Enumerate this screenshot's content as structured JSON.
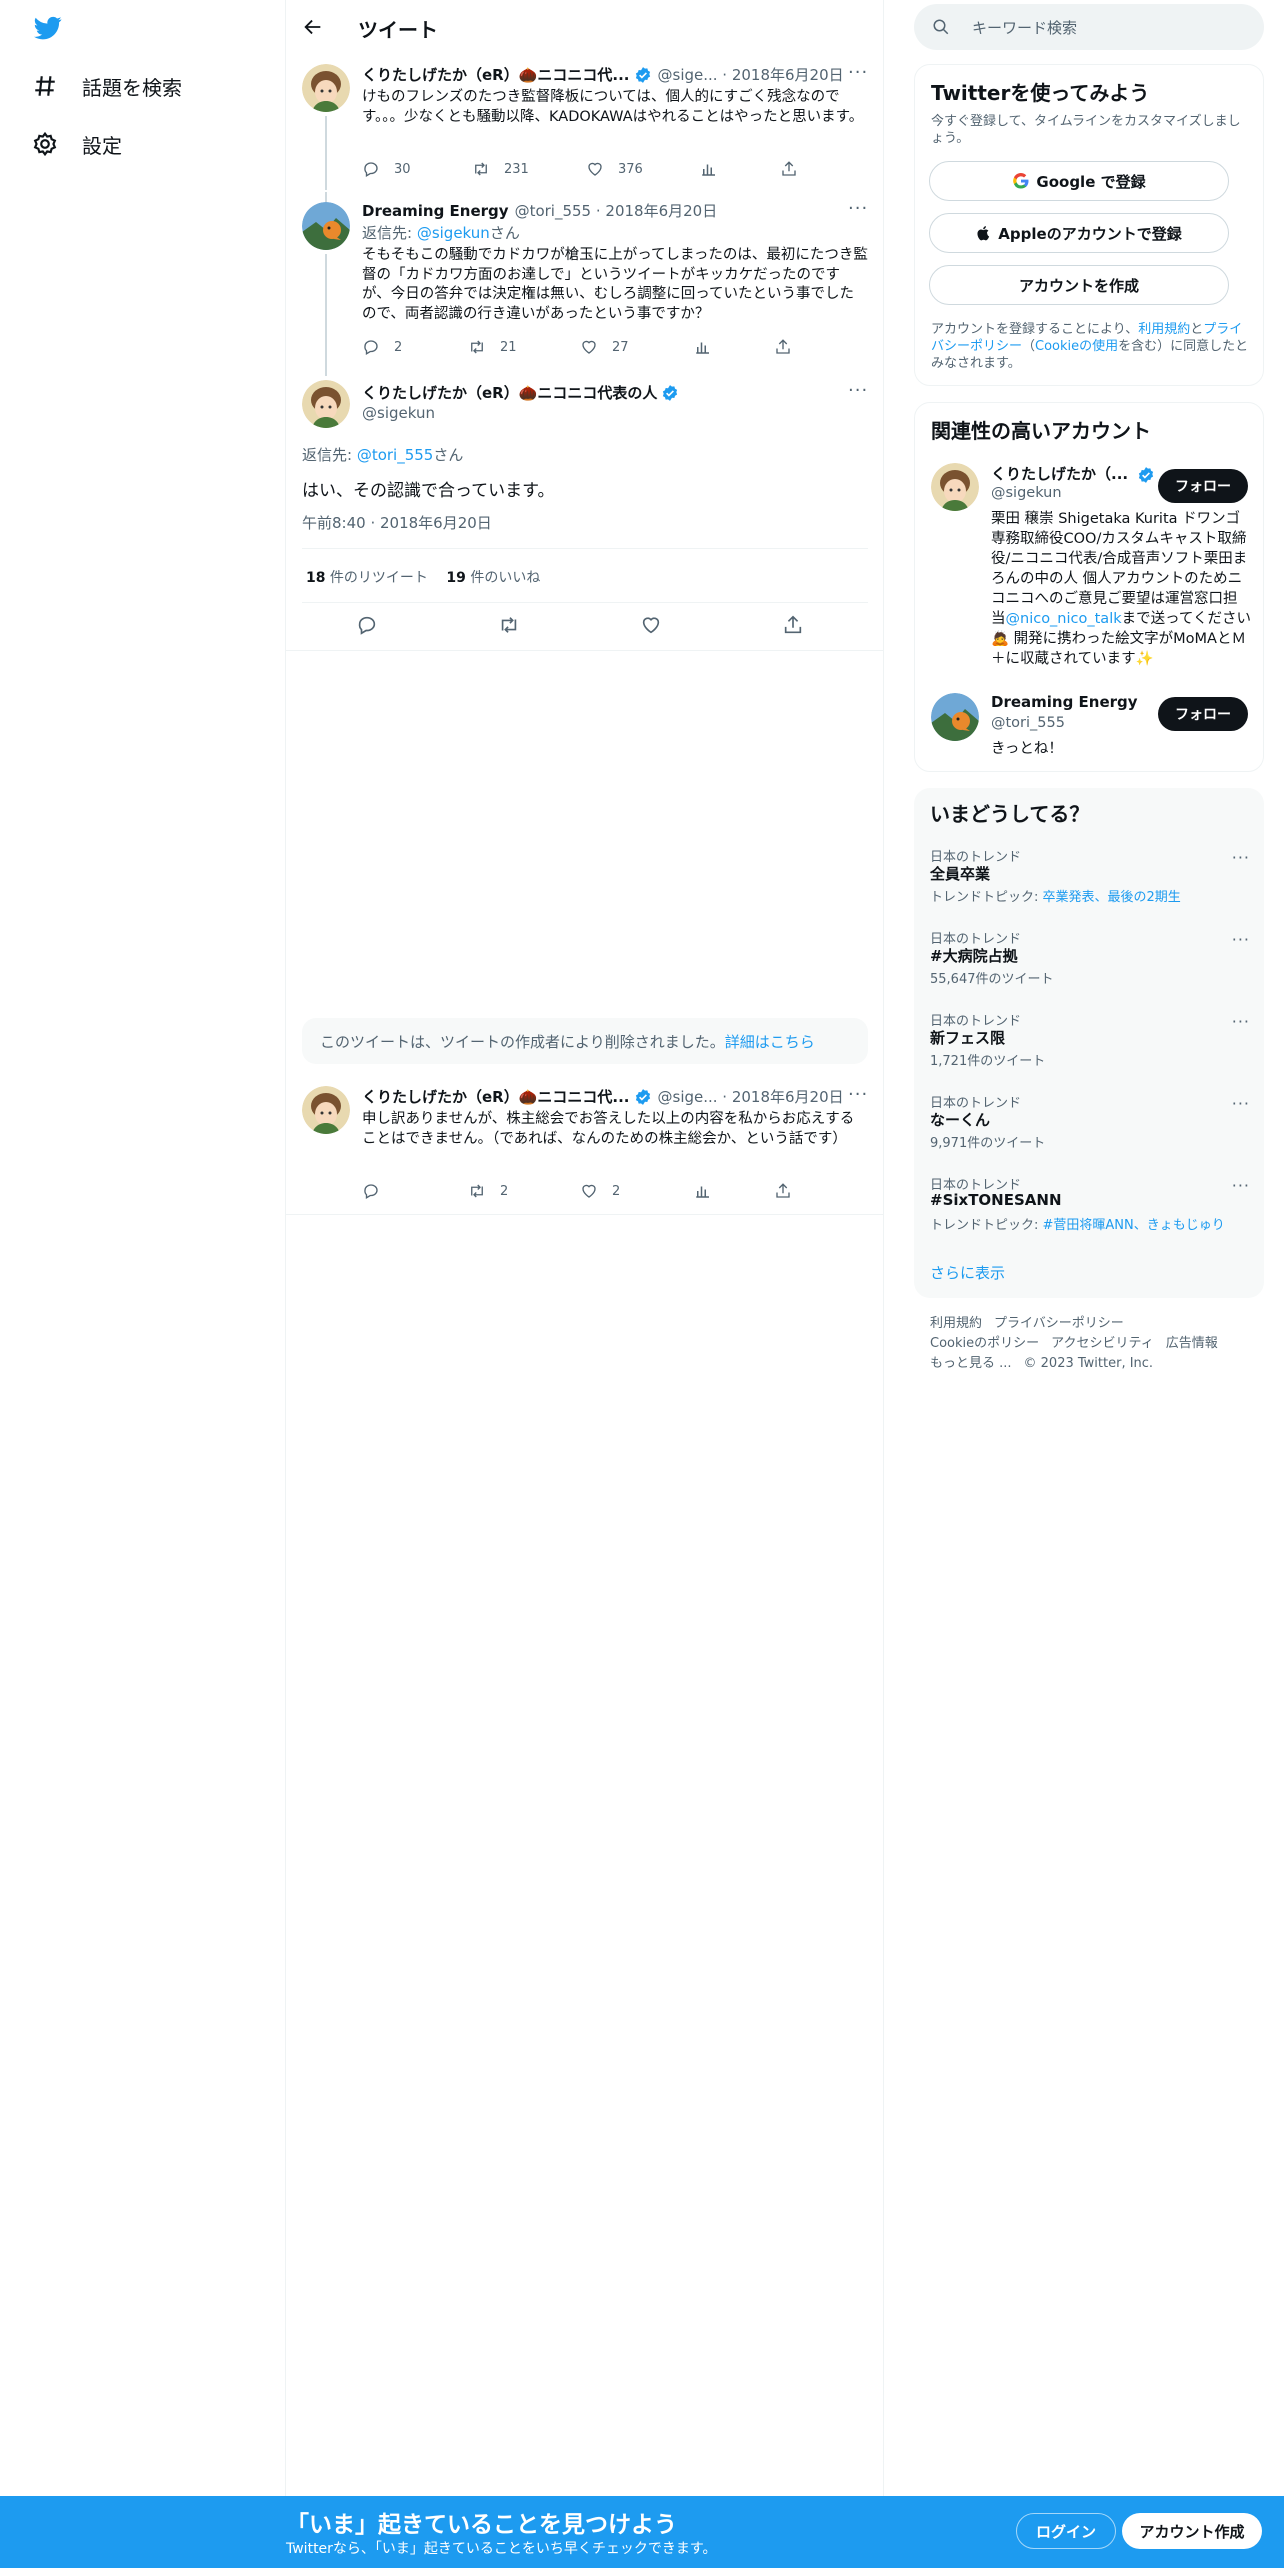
{
  "nav": {
    "explore_label": "話題を検索",
    "settings_label": "設定"
  },
  "header": {
    "title": "ツイート"
  },
  "tweets": [
    {
      "name": "くりたしげたか（eR）🌰ニコニコ代...",
      "meta": "@sige... · 2018年6月20日",
      "body": "けものフレンズのたつき監督降板については、個人的にすごく残念なのです。。。少なくとも騒動以降、KADOKAWAはやれることはやったと思います。",
      "replies": "30",
      "retweets": "231",
      "likes": "376"
    },
    {
      "name": "Dreaming Energy",
      "meta": "@tori_555 · 2018年6月20日",
      "reply_prefix": "返信先: ",
      "reply_to": "@sigekun",
      "reply_suffix": "さん",
      "body": "そもそもこの騒動でカドカワが槍玉に上がってしまったのは、最初にたつき監督の「カドカワ方面のお達しで」というツイートがキッカケだったのですが、今日の答弁では決定権は無い、むしろ調整に回っていたという事でしたので、両者認識の行き違いがあったという事ですか？",
      "replies": "2",
      "retweets": "21",
      "likes": "27"
    }
  ],
  "focus": {
    "name": "くりたしげたか（eR）🌰ニコニコ代表の人",
    "handle": "@sigekun",
    "reply_prefix": "返信先: ",
    "reply_to": "@tori_555",
    "reply_suffix": "さん",
    "body": "はい、その認識で合っています。",
    "time": "午前8:40 · 2018年6月20日",
    "retweet_count": "18",
    "retweet_label": " 件のリツイート",
    "like_count": "19",
    "like_label": " 件のいいね"
  },
  "deleted_notice": {
    "text": "このツイートは、ツイートの作成者により削除されました。",
    "link": "詳細はこちら"
  },
  "last_tweet": {
    "name": "くりたしげたか（eR）🌰ニコニコ代...",
    "meta": "@sige... · 2018年6月20日",
    "body": "申し訳ありませんが、株主総会でお答えした以上の内容を私からお応えすることはできません。（であれば、なんのための株主総会か、という話です）",
    "replies": "",
    "retweets": "2",
    "likes": "2"
  },
  "sidebar": {
    "search_placeholder": "キーワード検索",
    "signup": {
      "title": "Twitterを使ってみよう",
      "subtitle": "今すぐ登録して、タイムラインをカスタマイズしましょう。",
      "google_label": "Google で登録",
      "apple_label": "Appleのアカウントで登録",
      "create_label": "アカウントを作成",
      "terms_1": "アカウントを登録することにより、",
      "terms_link_1": "利用規約",
      "terms_2": "と",
      "terms_link_2": "プライバシーポリシー",
      "terms_3": "（",
      "terms_link_3": "Cookieの使用",
      "terms_4": "を含む）に同意したとみなされます。"
    },
    "relevant": {
      "title": "関連性の高いアカウント",
      "accounts": [
        {
          "name": "くりたしげたか（...",
          "handle": "@sigekun",
          "follow_label": "フォロー",
          "bio_1": "栗田 穣崇 Shigetaka Kurita ドワンゴ専務取締役COO/カスタムキャスト取締役/ニコニコ代表/合成音声ソフト栗田まろんの中の人 個人アカウントのためニコニコへのご意見ご要望は運営窓口担当",
          "bio_link": "@nico_nico_talk",
          "bio_2": "まで送ってください🙇 開発に携わった絵文字がMoMAとＭ＋に収蔵されています✨"
        },
        {
          "name": "Dreaming Energy",
          "handle": "@tori_555",
          "follow_label": "フォロー",
          "bio": "きっとね！"
        }
      ]
    },
    "trends": {
      "title": "いまどうしてる？",
      "items": [
        {
          "context": "日本のトレンド",
          "name": "全員卒業",
          "sub_label": "トレンドトピック: ",
          "sub_link": "卒業発表、最後の2期生"
        },
        {
          "context": "日本のトレンド",
          "name": "#大病院占拠",
          "sub": "55,647件のツイート"
        },
        {
          "context": "日本のトレンド",
          "name": "新フェス限",
          "sub": "1,721件のツイート"
        },
        {
          "context": "日本のトレンド",
          "name": "なーくん",
          "sub": "9,971件のツイート"
        },
        {
          "context": "日本のトレンド",
          "name": "#SixTONESANN",
          "sub_label": "トレンドトピック: ",
          "sub_link": "#菅田将暉ANN、きょもじゅり"
        }
      ],
      "show_more": "さらに表示"
    },
    "footer": {
      "links": [
        "利用規約",
        "プライバシーポリシー",
        "Cookieのポリシー",
        "アクセシビリティ",
        "広告情報",
        "もっと見る ..."
      ],
      "copyright": "© 2023 Twitter, Inc."
    }
  },
  "bottom_bar": {
    "title": "「いま」起きていることを見つけよう",
    "subtitle": "Twitterなら、「いま」起きていることをいち早くチェックできます。",
    "login_label": "ログイン",
    "signup_label": "アカウント作成"
  },
  "colors": {
    "accent": "#1d9bf0",
    "text": "#0f1419",
    "secondary": "#536471",
    "border": "#eff3f4"
  }
}
